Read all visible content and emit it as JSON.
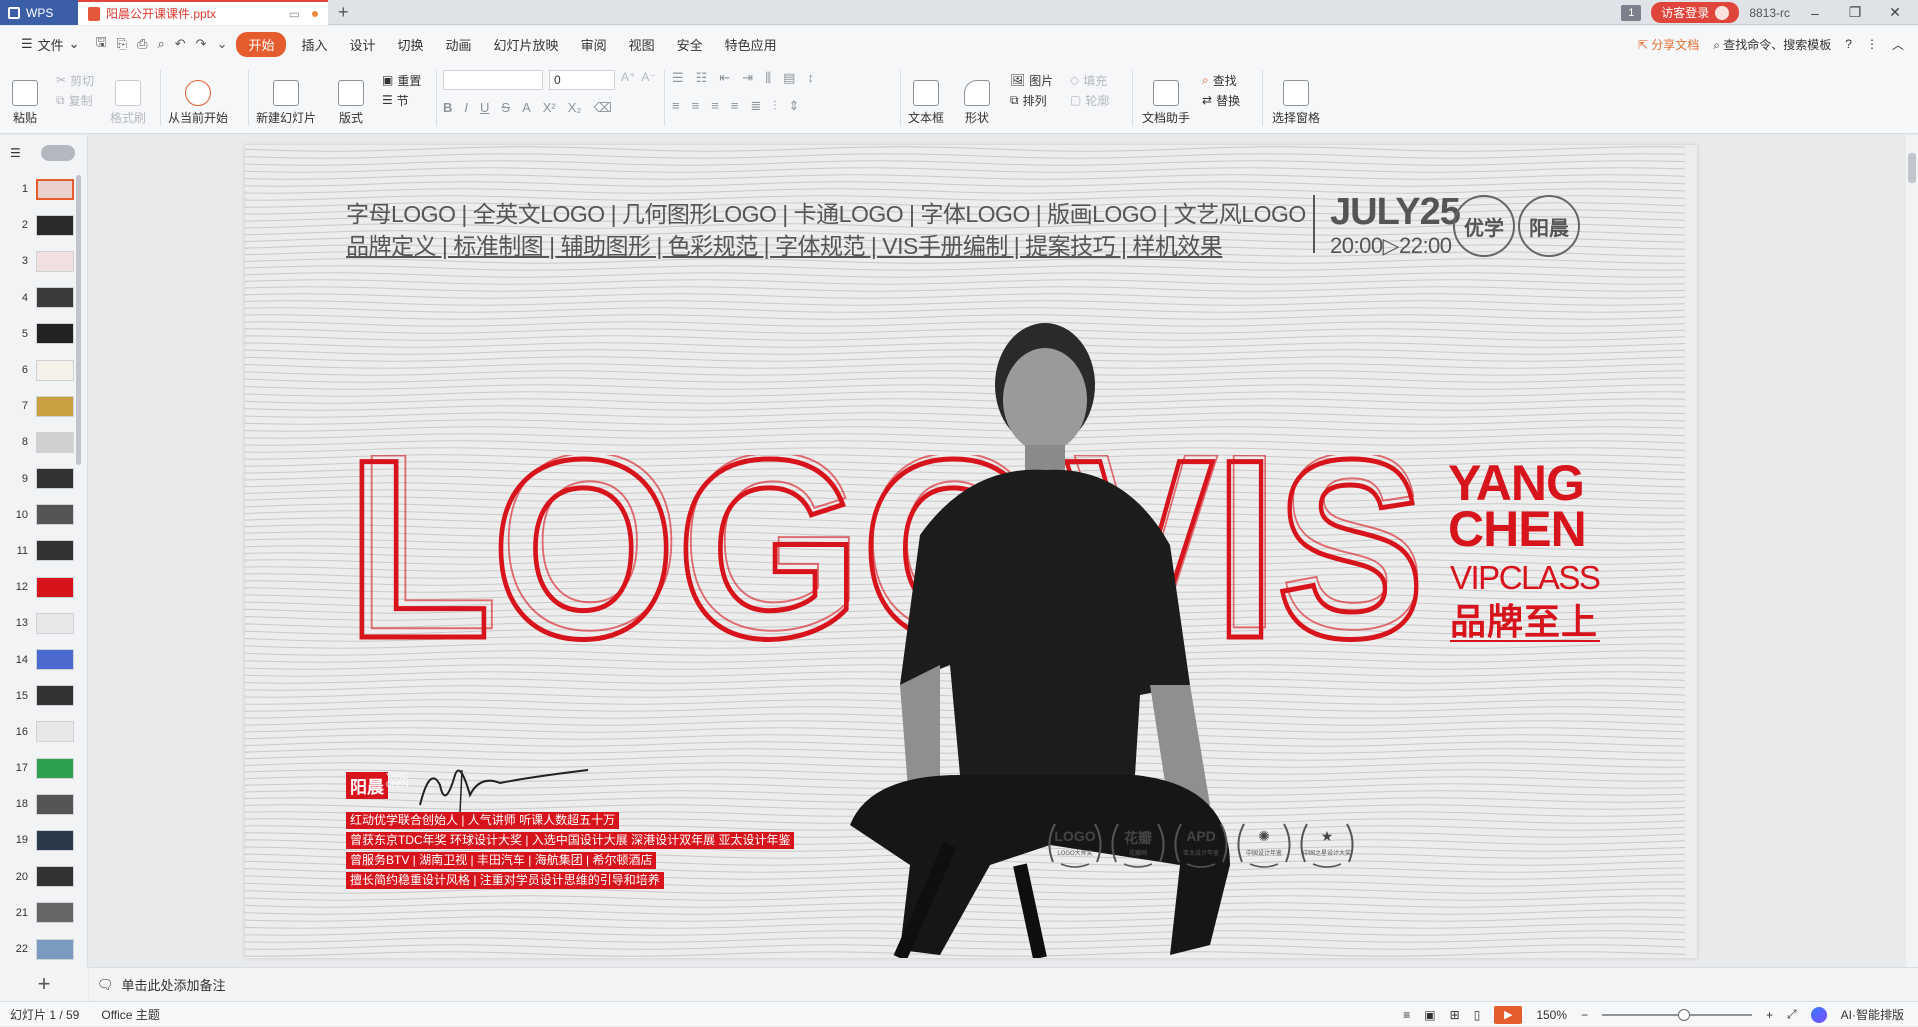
{
  "titlebar": {
    "app_name": "WPS",
    "doc_tab": "阳晨公开课课件.pptx",
    "new_tab": "+",
    "badge": "1",
    "visitor_login": "访客登录",
    "user_id": "8813-rc"
  },
  "menu": {
    "file": "文件",
    "items": [
      "开始",
      "插入",
      "设计",
      "切换",
      "动画",
      "幻灯片放映",
      "审阅",
      "视图",
      "安全",
      "特色应用"
    ],
    "share": "分享文档",
    "search": "查找命令、搜索模板"
  },
  "ribbon": {
    "paste": "粘贴",
    "cut": "剪切",
    "copy": "复制",
    "format_painter": "格式刷",
    "play_from_current": "从当前开始",
    "new_slide": "新建幻灯片",
    "layout": "版式",
    "reset": "重置",
    "section": "节",
    "font_size_value": "0",
    "textbox": "文本框",
    "shape": "形状",
    "picture": "图片",
    "arrange": "排列",
    "fill": "填充",
    "outline": "轮廓",
    "doc_assistant": "文档助手",
    "find": "查找",
    "replace": "替换",
    "selection_pane": "选择窗格"
  },
  "thumbnails": [
    "1",
    "2",
    "3",
    "4",
    "5",
    "6",
    "7",
    "8",
    "9",
    "10",
    "11",
    "12",
    "13",
    "14",
    "15",
    "16",
    "17",
    "18",
    "19",
    "20",
    "21",
    "22"
  ],
  "slide": {
    "line1": "字母LOGO | 全英文LOGO | 几何图形LOGO | 卡通LOGO | 字体LOGO | 版画LOGO | 文艺风LOGO",
    "line2": "品牌定义 | 标准制图 | 辅助图形 | 色彩规范 | 字体规范 | VIS手册编制 | 提案技巧 | 样机效果",
    "date": "JULY25",
    "time": "20:00▷22:00",
    "logo_a": "优学",
    "logo_b": "阳晨",
    "hero_logo": "LOGO",
    "hero_vis": "VIS",
    "yang": "YANG",
    "chen": "CHEN",
    "vipclass": "VIPCLASS",
    "slogan": "品牌至上",
    "sig_name": "阳晨",
    "sig_sub1": "YANG",
    "sig_sub2": "CHEN",
    "bio": [
      "红动优学联合创始人 | 人气讲师 听课人数超五十万",
      "曾获东京TDC年奖 环球设计大奖 | 入选中国设计大展 深港设计双年展 亚太设计年鉴",
      "曾服务BTV | 湖南卫视 | 丰田汽车 | 海航集团 | 希尔顿酒店",
      "擅长简约稳重设计风格 | 注重对学员设计思维的引导和培养"
    ],
    "awards": [
      {
        "label": "LOGO",
        "caption": "LOGO大师奖"
      },
      {
        "label": "花瓣",
        "caption": "花瓣网"
      },
      {
        "label": "APD",
        "caption": "亚太设计年鉴"
      },
      {
        "label": "✺",
        "caption": "中国设计年鉴"
      },
      {
        "label": "★",
        "caption": "中国之星设计大奖"
      }
    ]
  },
  "notes_placeholder": "单击此处添加备注",
  "status": {
    "slide_count": "幻灯片 1 / 59",
    "theme": "Office 主题",
    "zoom": "150%",
    "ai": "AI·智能排版"
  },
  "colors": {
    "accent": "#e55c2e",
    "brand_red": "#d7141c",
    "app_blue": "#3b5fa6"
  }
}
